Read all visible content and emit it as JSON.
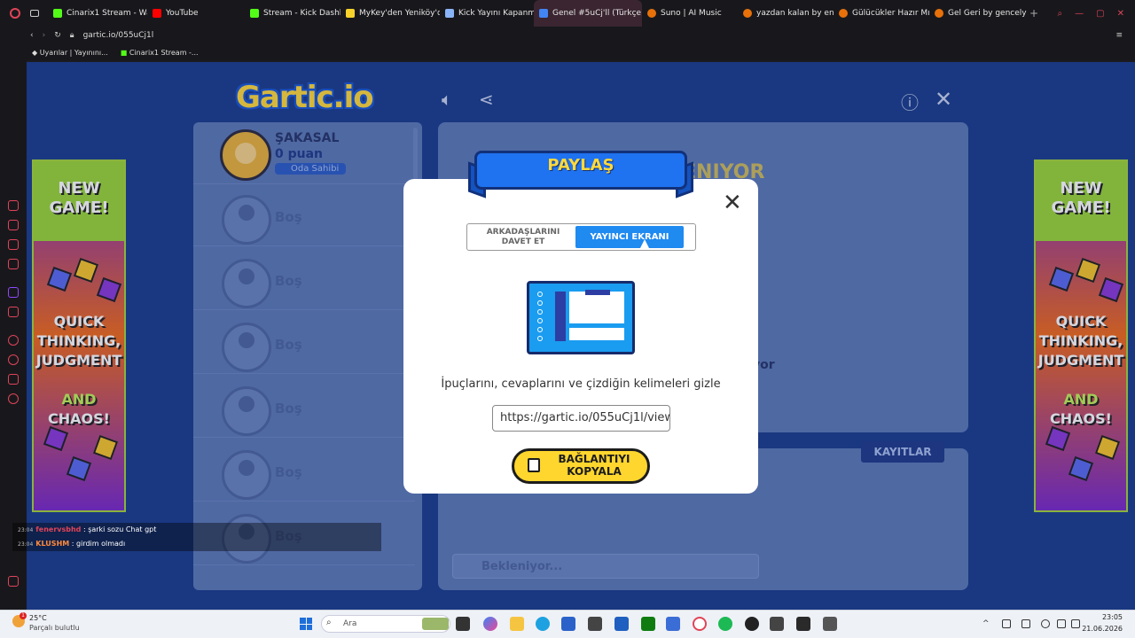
{
  "browser": {
    "tabs": [
      {
        "label": "Cinarix1 Stream - Wat",
        "color": "#53fc18"
      },
      {
        "label": "YouTube",
        "color": "#ff0000"
      },
      {
        "label": "Stream - Kick Dashbo",
        "color": "#53fc18"
      },
      {
        "label": "MyKey'den Yeniköy'd",
        "color": "#f7d22b"
      },
      {
        "label": "Kick Yayını Kapanma",
        "color": "#8ab4f8"
      },
      {
        "label": "Genel #5uCj'll (Türkçe) - D",
        "color": "#4285f4",
        "active": true
      },
      {
        "label": "Suno | AI Music",
        "color": "#e8710a"
      },
      {
        "label": "yazdan kalan by enes",
        "color": "#e8710a"
      },
      {
        "label": "Gülücükler Hazır Mı?",
        "color": "#e8710a"
      },
      {
        "label": "Gel Geri by gencelyes",
        "color": "#e8710a"
      }
    ],
    "url": "gartic.io/055uCj1l",
    "bookmarks": [
      "Uyarılar | Yayınını...",
      "Cinarix1 Stream -..."
    ]
  },
  "game": {
    "logo": "Gartic.io",
    "owner": {
      "name": "ŞAKASAL",
      "points": "0 puan",
      "badge": "Oda Sahibi"
    },
    "empty_slot_label": "Boş",
    "empty_slots": [
      "Boş",
      "Boş",
      "Boş",
      "Boş",
      "Boş",
      "Boş"
    ],
    "canvas_side_text": "yor",
    "canvas_title_fragment": "ENIYOR",
    "records_label": "KAYITLAR",
    "chat_placeholder": "Bekleniyor..."
  },
  "ads": {
    "headline": "NEW GAME!",
    "tagline": "QUICK THINKING, JUDGMENT",
    "and": "AND",
    "chaos": "CHAOS!"
  },
  "modal": {
    "title": "PAYLAŞ",
    "tab_invite": "ARKADAŞLARINI DAVET ET",
    "tab_streamer": "YAYINCI EKRANI",
    "description": "İpuçlarını, cevaplarını ve çizdiğin kelimeleri gizle",
    "link": "https://gartic.io/055uCj1l/view",
    "copy_button": "BAĞLANTIYI KOPYALA"
  },
  "stream_chat": [
    {
      "time": "23:04",
      "user": "fenervsbhd",
      "message": ": şarki sozu Chat gpt"
    },
    {
      "time": "23:04",
      "user": "KLUSHM",
      "message": ": girdim olmadı"
    }
  ],
  "taskbar": {
    "weather_temp": "25°C",
    "weather_desc": "Parçalı bulutlu",
    "weather_badge": "1",
    "search_placeholder": "Ara",
    "time": "23:05",
    "date": "21.06.2026"
  }
}
